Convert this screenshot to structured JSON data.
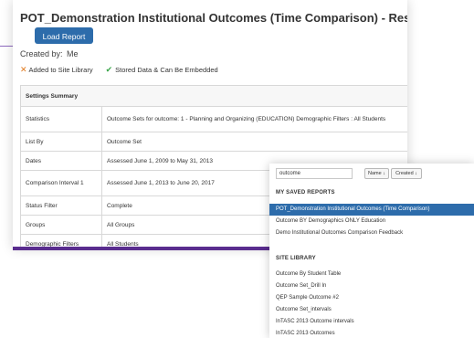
{
  "report": {
    "title": "POT_Demonstration Institutional Outcomes (Time Comparison) - Results Browse",
    "load_button_label": "Load Report",
    "created_by_label": "Created by:",
    "created_by_name": "Me",
    "status": {
      "added_to_library": "Added to Site Library",
      "stored_data": "Stored Data & Can Be Embedded"
    }
  },
  "settings": {
    "header": "Settings Summary",
    "rows": [
      {
        "label": "Statistics",
        "value": "Outcome Sets for outcome: 1 - Planning and Organizing (EDUCATION) Demographic Filters : All Students"
      },
      {
        "label": "List By",
        "value": "Outcome Set"
      },
      {
        "label": "Dates",
        "value": "Assessed June 1, 2009 to May 31, 2013"
      },
      {
        "label": "Comparison Interval 1",
        "value": "Assessed June 1, 2013 to June 20, 2017"
      },
      {
        "label": "Status Filter",
        "value": "Complete"
      },
      {
        "label": "Groups",
        "value": "All Groups"
      },
      {
        "label": "Demographic Filters",
        "value": "All Students"
      }
    ]
  },
  "browser": {
    "search_value": "outcome",
    "sort_name_label": "Name ↓",
    "sort_created_label": "Created ↓",
    "saved_heading": "MY SAVED REPORTS",
    "saved_reports": [
      "POT_Demonstration Institutional Outcomes (Time Comparison)",
      "Outcome BY Demographics ONLY Education",
      "Demo Institutional Outcomes Comparison Feedback"
    ],
    "library_heading": "SITE LIBRARY",
    "library_reports": [
      "Outcome By Student Table",
      "Outcome Set_Drill In",
      "QEP Sample Outcome #2",
      "Outcome Set_intervals",
      "InTASC 2013 Outcome intervals",
      "InTASC 2013 Outcomes"
    ]
  },
  "colors": {
    "accent_blue": "#2d6cab",
    "accent_purple": "#5a2d8f",
    "check_green": "#3aa64a",
    "x_orange": "#e07a1f"
  },
  "icons": {
    "added_to_library": "x-icon",
    "stored_data": "check-icon"
  }
}
